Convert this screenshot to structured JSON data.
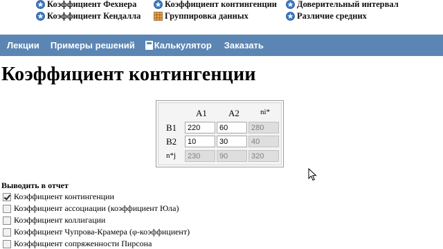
{
  "top_links": [
    {
      "label": "Коэффициент Фехнера",
      "icon": "blue-star-icon"
    },
    {
      "label": "Коэффициент контингенции",
      "icon": "blue-star-icon"
    },
    {
      "label": "Доверительный интервал",
      "icon": "blue-star-icon"
    },
    {
      "label": "Коэффициент Кендалла",
      "icon": "blue-star-icon"
    },
    {
      "label": "Группировка данных",
      "icon": "table-icon"
    },
    {
      "label": "Различие средних",
      "icon": "blue-star-icon"
    }
  ],
  "nav": {
    "lectures": "Лекции",
    "examples": "Примеры решений",
    "calculator": "Калькулятор",
    "order": "Заказать",
    "bg_color": "#5b86b4"
  },
  "page": {
    "title": "Коэффициент контингенции"
  },
  "table": {
    "col_headers": [
      "A1",
      "A2",
      "ni*"
    ],
    "rows": [
      {
        "label": "B1",
        "a1": "220",
        "a2": "60",
        "sum": "280"
      },
      {
        "label": "B2",
        "a1": "10",
        "a2": "30",
        "sum": "40"
      }
    ],
    "totals": {
      "label": "n*j",
      "a1": "230",
      "a2": "90",
      "sum": "320"
    }
  },
  "report": {
    "title": "Выводить в отчет",
    "options": [
      {
        "label": "Коэффициент контингенции",
        "checked": true
      },
      {
        "label": "Коэффициент ассоциации (коэффициент Юла)",
        "checked": false
      },
      {
        "label": "Коэффициент коллигации",
        "checked": false
      },
      {
        "label": "Коэффициент Чупрова-Крамера (φ-коэффициент)",
        "checked": false
      },
      {
        "label": "Коэффициент сопряженности Пирсона",
        "checked": false
      }
    ]
  }
}
